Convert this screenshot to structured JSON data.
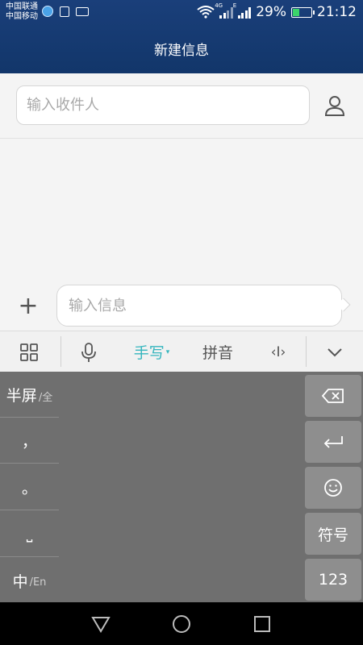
{
  "status_bar": {
    "carrier_1": "中国联通",
    "carrier_2": "中国移动",
    "network_1": "4G",
    "network_2": "E",
    "battery": "29%",
    "time": "21:12"
  },
  "header": {
    "title": "新建信息"
  },
  "recipient": {
    "placeholder": "输入收件人",
    "value": ""
  },
  "compose": {
    "placeholder": "输入信息",
    "value": ""
  },
  "keyboard": {
    "toolbar": {
      "handwrite_label": "手写",
      "pinyin_label": "拼音",
      "cursor_label": "‹I›",
      "active_mode": "手写"
    },
    "left_column": [
      {
        "label": "半屏",
        "sub": "/全"
      },
      {
        "label": "，",
        "sub": ""
      },
      {
        "label": "。",
        "sub": ""
      },
      {
        "label": "⎵",
        "sub": ""
      },
      {
        "label": "中",
        "sub": "/En"
      }
    ],
    "right_column": {
      "symbols_label": "符号",
      "numbers_label": "123"
    }
  },
  "colors": {
    "header_bg": "#12366a",
    "accent": "#36b6be",
    "keyboard_bg": "#6f6f6f"
  }
}
